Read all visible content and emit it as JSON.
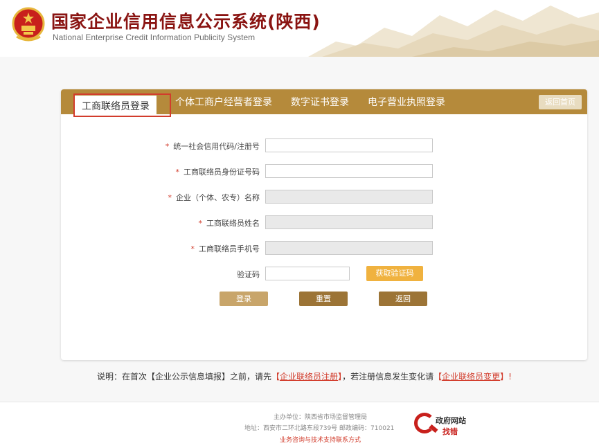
{
  "header": {
    "title": "国家企业信用信息公示系统(陕西)",
    "subtitle": "National Enterprise Credit Information Publicity System"
  },
  "tabs": [
    {
      "label": "工商联络员登录",
      "active": true
    },
    {
      "label": "个体工商户经营者登录",
      "active": false
    },
    {
      "label": "数字证书登录",
      "active": false
    },
    {
      "label": "电子营业执照登录",
      "active": false
    }
  ],
  "home_button": "返回首页",
  "form": {
    "fields": [
      {
        "label": "统一社会信用代码/注册号",
        "required": true,
        "value": "",
        "disabled": false
      },
      {
        "label": "工商联络员身份证号码",
        "required": true,
        "value": "",
        "disabled": false
      },
      {
        "label": "企业（个体、农专）名称",
        "required": true,
        "value": "",
        "disabled": true
      },
      {
        "label": "工商联络员姓名",
        "required": true,
        "value": "",
        "disabled": true
      },
      {
        "label": "工商联络员手机号",
        "required": true,
        "value": "",
        "disabled": true
      }
    ],
    "captcha_label": "验证码",
    "captcha_value": "",
    "required_mark": "*",
    "get_code_button": "获取验证码",
    "login_button": "登录",
    "reset_button": "重置",
    "back_button": "返回"
  },
  "notice": {
    "prefix": "说明：在首次【企业公示信息填报】之前，请先",
    "link1_open": "【",
    "link1": "企业联络员注册",
    "link1_close": "】",
    "middle": "，若注册信息发生变化请",
    "link2_open": "【",
    "link2": "企业联络员变更",
    "link2_close": "】",
    "suffix": "!"
  },
  "footer": {
    "organizer": "主办单位：陕西省市场监督管理局",
    "address": "地址：西安市二环北路东段739号    邮政编码：710021",
    "support": "业务咨询与技术支持联系方式",
    "badge_line1": "政府网站",
    "badge_line2": "找错"
  },
  "colors": {
    "tab_bar": "#b58a3b",
    "title": "#8a1412",
    "highlight": "#d23c2c",
    "code_button": "#f0b23f"
  }
}
